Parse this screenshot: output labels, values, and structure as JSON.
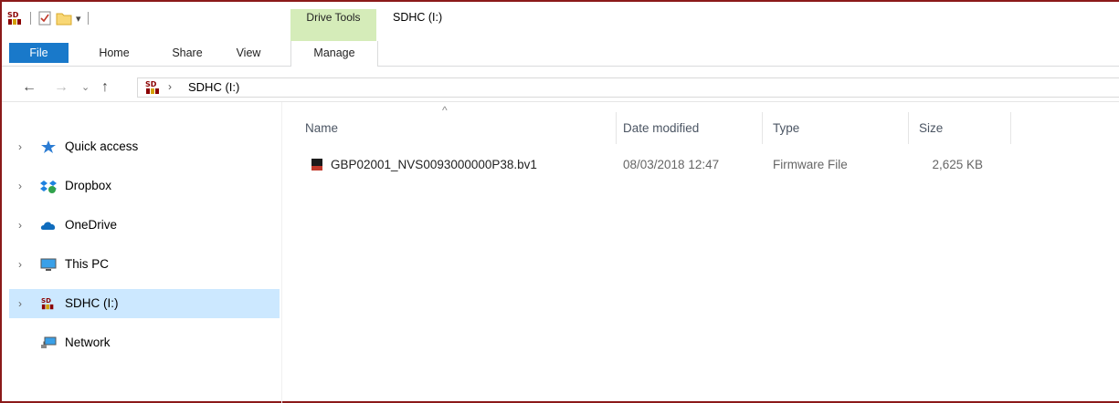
{
  "window": {
    "context_tab": "Drive Tools",
    "title": "SDHC (I:)"
  },
  "ribbon": {
    "tabs": [
      "File",
      "Home",
      "Share",
      "View"
    ],
    "manage_tab": "Manage"
  },
  "address": {
    "path": "SDHC (I:)"
  },
  "nav_pane": {
    "items": [
      {
        "label": "Quick access",
        "icon": "star-icon",
        "expandable": true
      },
      {
        "label": "Dropbox",
        "icon": "dropbox-icon",
        "expandable": true
      },
      {
        "label": "OneDrive",
        "icon": "onedrive-cloud-icon",
        "expandable": true
      },
      {
        "label": "This PC",
        "icon": "monitor-icon",
        "expandable": true
      },
      {
        "label": "SDHC (I:)",
        "icon": "sd-card-icon",
        "expandable": true,
        "selected": true
      },
      {
        "label": "Network",
        "icon": "network-icon",
        "expandable": false
      }
    ]
  },
  "file_list": {
    "columns": [
      "Name",
      "Date modified",
      "Type",
      "Size"
    ],
    "rows": [
      {
        "name": "GBP02001_NVS0093000000P38.bv1",
        "date": "08/03/2018 12:47",
        "type": "Firmware File",
        "size": "2,625 KB"
      }
    ]
  },
  "colors": {
    "file_tab": "#1979ca",
    "drive_tools": "#d5ecb9",
    "selection": "#cce8ff",
    "window_border": "#8b1a1a"
  }
}
